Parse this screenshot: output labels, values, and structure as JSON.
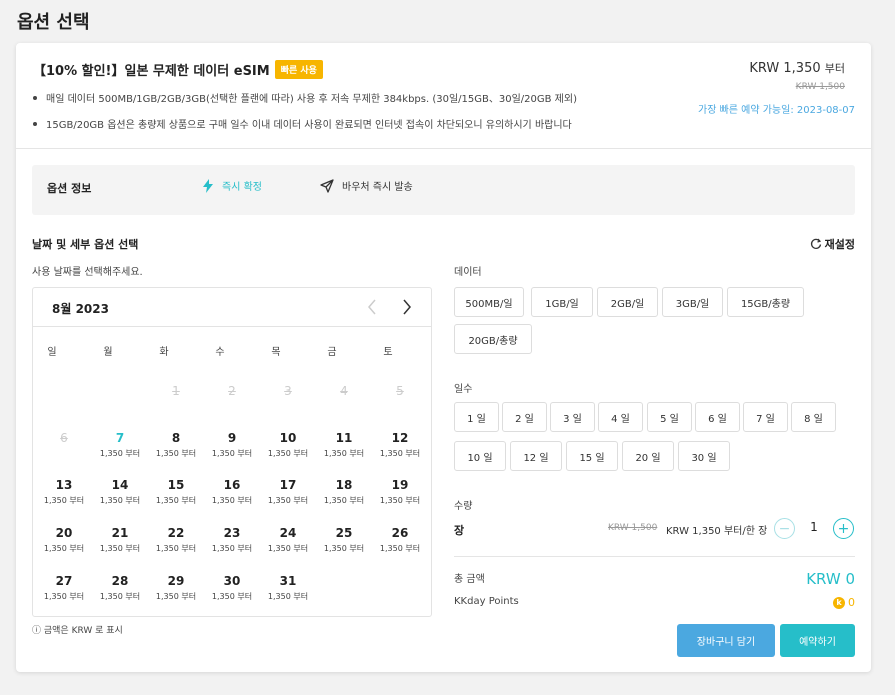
{
  "page": {
    "title": "옵션 선택"
  },
  "product": {
    "title": "【10% 할인!】일본 무제한 데이터 eSIM",
    "badge": "빠른 사용",
    "bullets": [
      "매일 데이터 500MB/1GB/2GB/3GB(선택한 플랜에 따라) 사용 후 저속 무제한 384kbps. (30일/15GB、30일/20GB 제외)",
      "15GB/20GB 옵션은 총량제 상품으로 구매 일수 이내 데이터 사용이 완료되면 인터넷 접속이 차단되오니 유의하시기 바랍니다"
    ],
    "price": "KRW 1,350",
    "price_suffix": "부터",
    "original_price": "KRW 1,500",
    "earliest_booking": "가장 빠른 예약 가능일: 2023-08-07"
  },
  "option_info": {
    "label": "옵션 정보",
    "instant_confirm": "즉시 확정",
    "voucher": "바우처 즉시 발송"
  },
  "selection": {
    "title": "날짜 및 세부 옵션 선택",
    "reset": "재설정",
    "calendar_hint": "사용 날짜를 선택해주세요."
  },
  "calendar": {
    "month_label": "8월 2023",
    "weekdays": [
      "일",
      "월",
      "화",
      "수",
      "목",
      "금",
      "토"
    ],
    "price_label": "1,350 부터",
    "days": [
      {
        "d": "1",
        "disabled": true
      },
      {
        "d": "2",
        "disabled": true
      },
      {
        "d": "3",
        "disabled": true
      },
      {
        "d": "4",
        "disabled": true
      },
      {
        "d": "5",
        "disabled": true
      },
      {
        "d": "6",
        "disabled": true
      },
      {
        "d": "7",
        "today": true
      },
      {
        "d": "8"
      },
      {
        "d": "9"
      },
      {
        "d": "10"
      },
      {
        "d": "11"
      },
      {
        "d": "12"
      },
      {
        "d": "13"
      },
      {
        "d": "14"
      },
      {
        "d": "15"
      },
      {
        "d": "16"
      },
      {
        "d": "17"
      },
      {
        "d": "18"
      },
      {
        "d": "19"
      },
      {
        "d": "20"
      },
      {
        "d": "21"
      },
      {
        "d": "22"
      },
      {
        "d": "23"
      },
      {
        "d": "24"
      },
      {
        "d": "25"
      },
      {
        "d": "26"
      },
      {
        "d": "27"
      },
      {
        "d": "28"
      },
      {
        "d": "29"
      },
      {
        "d": "30"
      },
      {
        "d": "31"
      }
    ],
    "first_weekday": 2,
    "currency_note": "금액은 KRW 로 표시"
  },
  "data_options": {
    "label": "데이터",
    "items": [
      "500MB/일",
      "1GB/일",
      "2GB/일",
      "3GB/일",
      "15GB/총량",
      "20GB/총량"
    ]
  },
  "days_options": {
    "label": "일수",
    "items": [
      "1 일",
      "2 일",
      "3 일",
      "4 일",
      "5 일",
      "6 일",
      "7 일",
      "8 일",
      "10 일",
      "12 일",
      "15 일",
      "20 일",
      "30 일"
    ]
  },
  "quantity": {
    "label": "수량",
    "unit": "장",
    "original_price": "KRW 1,500",
    "price": "KRW 1,350 부터/한 장",
    "minus": "−",
    "value": "1",
    "plus": "+"
  },
  "total": {
    "label": "총 금액",
    "value": "KRW 0"
  },
  "points": {
    "label": "KKday Points",
    "coin": "k",
    "value": "0"
  },
  "buttons": {
    "cart": "장바구니 담기",
    "book": "예약하기"
  },
  "colors": {
    "accent": "#26bec9",
    "blue": "#4ba8e0",
    "badge": "#f7b500"
  }
}
